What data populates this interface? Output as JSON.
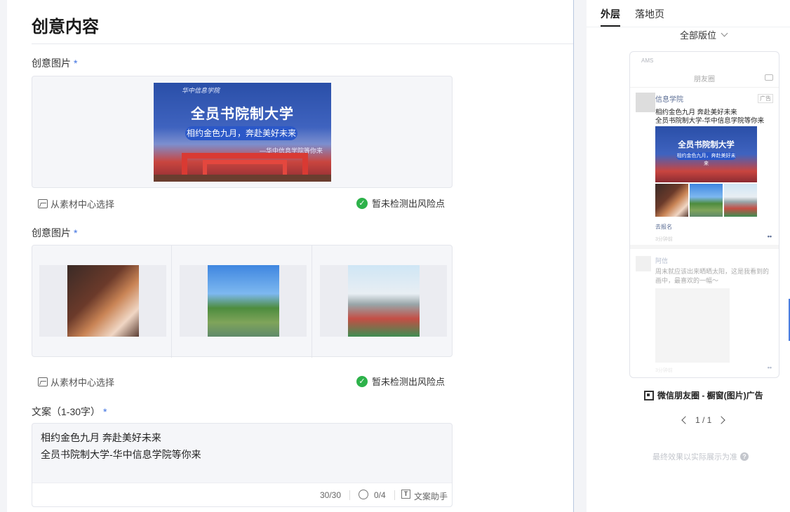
{
  "section_title": "创意内容",
  "fields": {
    "image1_label": "创意图片",
    "image2_label": "创意图片",
    "copy_label": "文案（1-30字）",
    "required_mark": "*"
  },
  "banner": {
    "logo_text": "华中信息学院",
    "title": "全员书院制大学",
    "pill": "相约金色九月，奔赴美好未来",
    "note": "—华中信息学院等你来"
  },
  "tools": {
    "select_from_library": "从素材中心选择",
    "risk_status": "暂未检测出风险点"
  },
  "copy": {
    "line1": "相约金色九月 奔赴美好未来",
    "line2": "全员书院制大学-华中信息学院等你来",
    "char_count": "30/30",
    "emoji_count": "0/4",
    "assistant": "文案助手"
  },
  "preview": {
    "tabs": [
      "外层",
      "落地页"
    ],
    "placement": "全部版位",
    "status_bar": "AMS",
    "nav_title": "朋友圈",
    "account_name": "信息学院",
    "ad_tag": "广告",
    "text_line1": "相约金色九月 奔赴美好未来",
    "text_line2": "全员书院制大学-华中信息学院等你来",
    "banner_title": "全员书院制大学",
    "banner_pill": "相约金色九月，奔赴美好未来",
    "link_text": "去报名",
    "time_text": "3分钟前",
    "friend_name": "阿信",
    "friend_text": "周末就应该出来晒晒太阳，这是我看到的画中，最喜欢的一幅～",
    "friend_time": "3分钟前",
    "ad_type": "微信朋友圈 - 橱窗(图片)广告",
    "pager": "1 / 1",
    "note": "最终效果以实际展示为准"
  }
}
